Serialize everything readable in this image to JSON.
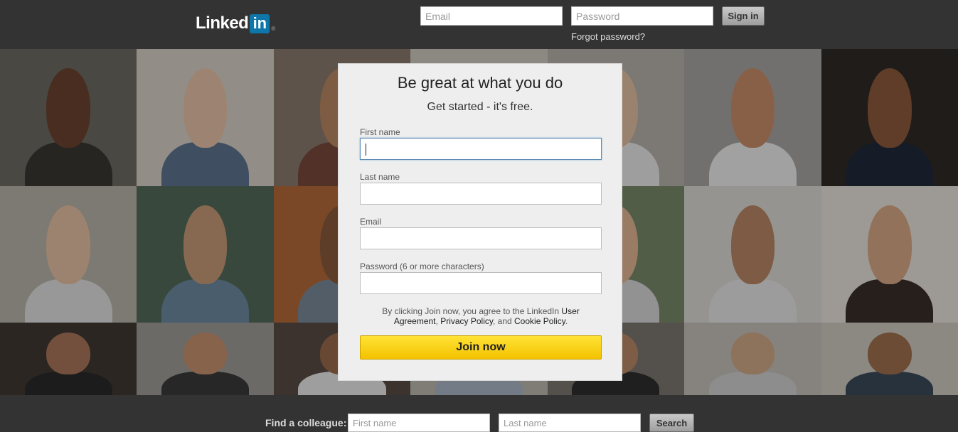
{
  "header": {
    "logo_text": "Linked",
    "logo_badge": "in",
    "logo_mark": "®",
    "email_placeholder": "Email",
    "password_placeholder": "Password",
    "sign_in_label": "Sign in",
    "forgot_password_label": "Forgot password?"
  },
  "signup": {
    "title": "Be great at what you do",
    "subtitle": "Get started - it's free.",
    "first_name_label": "First name",
    "last_name_label": "Last name",
    "email_label": "Email",
    "password_label": "Password (6 or more characters)",
    "terms_prefix": "By clicking Join now, you agree to the LinkedIn ",
    "terms_user_agreement": "User Agreement",
    "terms_sep1": ", ",
    "terms_privacy": "Privacy Policy",
    "terms_sep2": ", and ",
    "terms_cookie": "Cookie Policy",
    "terms_end": ".",
    "join_label": "Join now"
  },
  "footer": {
    "find_label": "Find a colleague:",
    "first_name_placeholder": "First name",
    "last_name_placeholder": "Last name",
    "search_label": "Search"
  },
  "colors": {
    "brand_blue": "#0e76a8",
    "join_yellow": "#f3c200",
    "bar_dark": "#333333"
  }
}
